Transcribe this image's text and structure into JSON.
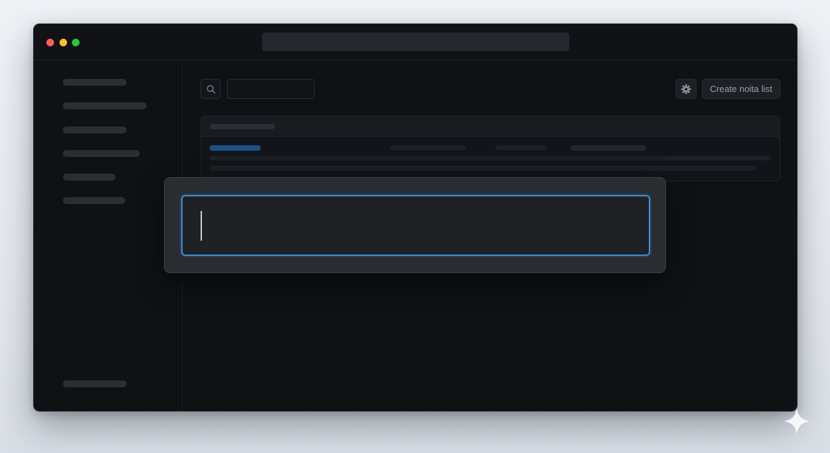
{
  "toolbar": {
    "create_button_label": "Create noita list"
  },
  "overlay": {
    "input_value": ""
  },
  "icons": {
    "search": "search-icon",
    "settings": "gear-icon",
    "watermark": "sparkle-icon"
  },
  "colors": {
    "accent": "#3a8fd6",
    "traffic_red": "#ff5f57",
    "traffic_yellow": "#febc2e",
    "traffic_green": "#28c840"
  }
}
